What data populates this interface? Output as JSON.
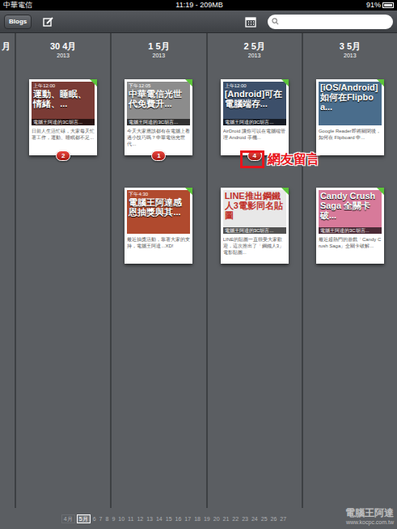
{
  "status_bar": {
    "carrier": "中華電信",
    "time": "11:19 - 209MB",
    "battery": "91%"
  },
  "toolbar": {
    "blogs_button": "Blogs",
    "search": {
      "placeholder": ""
    }
  },
  "partial_column": {
    "month": "月"
  },
  "columns": [
    {
      "day": "30",
      "month": "4月",
      "year": "2013",
      "cards": [
        {
          "time": "上午12:00",
          "title": "運動、睡眠、情緒、...",
          "footer": "電腦王阿達的3C胡言...",
          "snippet": "日前人生活忙碌，大家每天忙著工作，運動、睡眠都不足...",
          "comments": "2",
          "published": true
        }
      ]
    },
    {
      "day": "1",
      "month": "5月",
      "year": "2013",
      "cards": [
        {
          "time": "下午12:05",
          "title": "中華電信光世代免費升...",
          "footer": "電腦王阿達的3C胡言...",
          "snippet": "今天大家應該都有在電腦上看過小技巧嗎？中華電信光世代...",
          "comments": "1",
          "published": true
        },
        {
          "time": "下午4:30",
          "title": "電腦王阿達感恩抽獎與其...",
          "footer": "",
          "snippet": "最近抽獎活動，靠著大家的支持，電腦王阿達...XD!",
          "published": true
        }
      ]
    },
    {
      "day": "2",
      "month": "5月",
      "year": "2013",
      "cards": [
        {
          "time": "上午12:00",
          "title": "[Android]可在電腦端存...",
          "footer": "電腦王阿達的3C胡言...",
          "snippet": "AirDroid 讓你可以在電腦端管理 Android 手機...",
          "comments": "4",
          "annotation": "網友留言",
          "published": true
        },
        {
          "time": "",
          "title": "LINE推出鋼鐵人3電影同名貼圖",
          "footer": "電腦王阿達的3C胡言...",
          "snippet": "LINE的貼圖一直很受大家歡迎，這次推出了「鋼鐵人3」電影貼圖...",
          "published": true
        }
      ]
    },
    {
      "day": "3",
      "month": "5月",
      "year": "2013",
      "cards": [
        {
          "time": "",
          "title": "[iOS/Android]如何在Flipboa...",
          "footer": "",
          "snippet": "Google Reader即將關閉後，如何在 Flipboard 中...",
          "published": true
        },
        {
          "time": "",
          "title": "Candy Crush Saga 全關卡破...",
          "footer": "電腦王阿達的3C胡言...",
          "snippet": "最近超熱門的遊戲「Candy Crush Saga」全關卡破解...",
          "published": true
        }
      ]
    }
  ],
  "pagination": {
    "months": [
      {
        "label": "4月",
        "selected": false
      },
      {
        "label": "5月",
        "selected": true
      }
    ],
    "days": [
      "6",
      "7",
      "8",
      "9",
      "10",
      "11",
      "12",
      "13",
      "14",
      "15",
      "16",
      "17",
      "18",
      "19",
      "20",
      "21",
      "22",
      "23",
      "24",
      "25",
      "26",
      "27"
    ]
  },
  "watermark": {
    "name": "電腦王阿達",
    "url": "www.kocpc.com.tw"
  }
}
